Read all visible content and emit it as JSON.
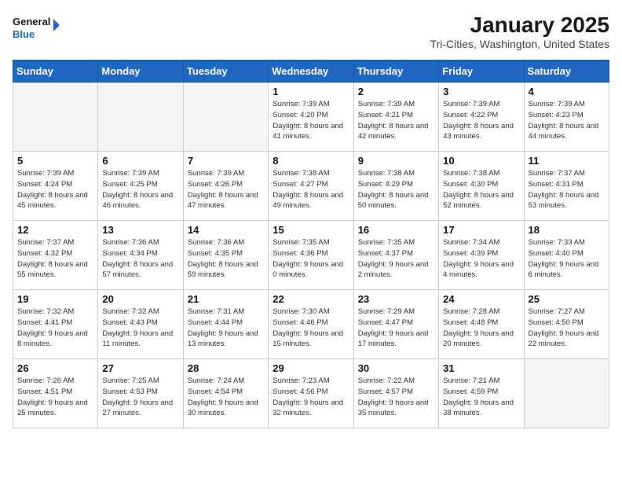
{
  "logo": {
    "line1": "General",
    "line2": "Blue"
  },
  "title": "January 2025",
  "subtitle": "Tri-Cities, Washington, United States",
  "days_of_week": [
    "Sunday",
    "Monday",
    "Tuesday",
    "Wednesday",
    "Thursday",
    "Friday",
    "Saturday"
  ],
  "weeks": [
    [
      {
        "day": "",
        "detail": ""
      },
      {
        "day": "",
        "detail": ""
      },
      {
        "day": "",
        "detail": ""
      },
      {
        "day": "1",
        "detail": "Sunrise: 7:39 AM\nSunset: 4:20 PM\nDaylight: 8 hours and 41 minutes."
      },
      {
        "day": "2",
        "detail": "Sunrise: 7:39 AM\nSunset: 4:21 PM\nDaylight: 8 hours and 42 minutes."
      },
      {
        "day": "3",
        "detail": "Sunrise: 7:39 AM\nSunset: 4:22 PM\nDaylight: 8 hours and 43 minutes."
      },
      {
        "day": "4",
        "detail": "Sunrise: 7:39 AM\nSunset: 4:23 PM\nDaylight: 8 hours and 44 minutes."
      }
    ],
    [
      {
        "day": "5",
        "detail": "Sunrise: 7:39 AM\nSunset: 4:24 PM\nDaylight: 8 hours and 45 minutes."
      },
      {
        "day": "6",
        "detail": "Sunrise: 7:39 AM\nSunset: 4:25 PM\nDaylight: 8 hours and 46 minutes."
      },
      {
        "day": "7",
        "detail": "Sunrise: 7:39 AM\nSunset: 4:26 PM\nDaylight: 8 hours and 47 minutes."
      },
      {
        "day": "8",
        "detail": "Sunrise: 7:38 AM\nSunset: 4:27 PM\nDaylight: 8 hours and 49 minutes."
      },
      {
        "day": "9",
        "detail": "Sunrise: 7:38 AM\nSunset: 4:29 PM\nDaylight: 8 hours and 50 minutes."
      },
      {
        "day": "10",
        "detail": "Sunrise: 7:38 AM\nSunset: 4:30 PM\nDaylight: 8 hours and 52 minutes."
      },
      {
        "day": "11",
        "detail": "Sunrise: 7:37 AM\nSunset: 4:31 PM\nDaylight: 8 hours and 53 minutes."
      }
    ],
    [
      {
        "day": "12",
        "detail": "Sunrise: 7:37 AM\nSunset: 4:32 PM\nDaylight: 8 hours and 55 minutes."
      },
      {
        "day": "13",
        "detail": "Sunrise: 7:36 AM\nSunset: 4:34 PM\nDaylight: 8 hours and 57 minutes."
      },
      {
        "day": "14",
        "detail": "Sunrise: 7:36 AM\nSunset: 4:35 PM\nDaylight: 8 hours and 59 minutes."
      },
      {
        "day": "15",
        "detail": "Sunrise: 7:35 AM\nSunset: 4:36 PM\nDaylight: 9 hours and 0 minutes."
      },
      {
        "day": "16",
        "detail": "Sunrise: 7:35 AM\nSunset: 4:37 PM\nDaylight: 9 hours and 2 minutes."
      },
      {
        "day": "17",
        "detail": "Sunrise: 7:34 AM\nSunset: 4:39 PM\nDaylight: 9 hours and 4 minutes."
      },
      {
        "day": "18",
        "detail": "Sunrise: 7:33 AM\nSunset: 4:40 PM\nDaylight: 9 hours and 6 minutes."
      }
    ],
    [
      {
        "day": "19",
        "detail": "Sunrise: 7:32 AM\nSunset: 4:41 PM\nDaylight: 9 hours and 8 minutes."
      },
      {
        "day": "20",
        "detail": "Sunrise: 7:32 AM\nSunset: 4:43 PM\nDaylight: 9 hours and 11 minutes."
      },
      {
        "day": "21",
        "detail": "Sunrise: 7:31 AM\nSunset: 4:44 PM\nDaylight: 9 hours and 13 minutes."
      },
      {
        "day": "22",
        "detail": "Sunrise: 7:30 AM\nSunset: 4:46 PM\nDaylight: 9 hours and 15 minutes."
      },
      {
        "day": "23",
        "detail": "Sunrise: 7:29 AM\nSunset: 4:47 PM\nDaylight: 9 hours and 17 minutes."
      },
      {
        "day": "24",
        "detail": "Sunrise: 7:28 AM\nSunset: 4:48 PM\nDaylight: 9 hours and 20 minutes."
      },
      {
        "day": "25",
        "detail": "Sunrise: 7:27 AM\nSunset: 4:50 PM\nDaylight: 9 hours and 22 minutes."
      }
    ],
    [
      {
        "day": "26",
        "detail": "Sunrise: 7:26 AM\nSunset: 4:51 PM\nDaylight: 9 hours and 25 minutes."
      },
      {
        "day": "27",
        "detail": "Sunrise: 7:25 AM\nSunset: 4:53 PM\nDaylight: 9 hours and 27 minutes."
      },
      {
        "day": "28",
        "detail": "Sunrise: 7:24 AM\nSunset: 4:54 PM\nDaylight: 9 hours and 30 minutes."
      },
      {
        "day": "29",
        "detail": "Sunrise: 7:23 AM\nSunset: 4:56 PM\nDaylight: 9 hours and 32 minutes."
      },
      {
        "day": "30",
        "detail": "Sunrise: 7:22 AM\nSunset: 4:57 PM\nDaylight: 9 hours and 35 minutes."
      },
      {
        "day": "31",
        "detail": "Sunrise: 7:21 AM\nSunset: 4:59 PM\nDaylight: 9 hours and 38 minutes."
      },
      {
        "day": "",
        "detail": ""
      }
    ]
  ]
}
